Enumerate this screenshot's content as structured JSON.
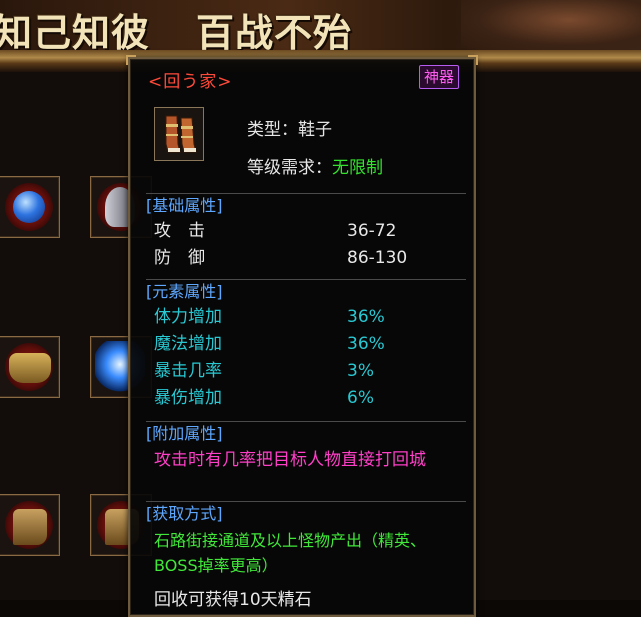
{
  "banner": {
    "slogan_left": "知己知彼",
    "slogan_right": "百战不殆"
  },
  "tooltip": {
    "item_name": "<回う家>",
    "badge": "神器",
    "type_label": "类型：",
    "type_value": "鞋子",
    "level_label": "等级需求：",
    "level_value": "无限制",
    "base_section": {
      "title": "[基础属性]",
      "rows": [
        {
          "label": "攻　击",
          "value": "36-72"
        },
        {
          "label": "防　御",
          "value": "86-130"
        }
      ]
    },
    "element_section": {
      "title": "[元素属性]",
      "rows": [
        {
          "label": "体力增加",
          "value": "36%"
        },
        {
          "label": "魔法增加",
          "value": "36%"
        },
        {
          "label": "暴击几率",
          "value": "3%"
        },
        {
          "label": "暴伤增加",
          "value": "6%"
        }
      ]
    },
    "extra_section": {
      "title": "[附加属性]",
      "text": "攻击时有几率把目标人物直接打回城"
    },
    "source_section": {
      "title": "[获取方式]",
      "text": "石路街接通道及以上怪物产出（精英、BOSS掉率更高）"
    },
    "footer": "回收可获得10天精石"
  },
  "colors": {
    "item_name": "#ff4a3a",
    "badge": "#ff5cf2",
    "section_title": "#5ea8ff",
    "element_value": "#29c9d3",
    "extra_text": "#ff3fc8",
    "source_text": "#40e83a",
    "level_value": "#33e12e"
  },
  "inventory_icons": [
    "sapphire-ring-icon",
    "helmet-icon",
    "gold-armor-icon",
    "lightning-gem-icon",
    "boots-icon",
    "boots-icon"
  ]
}
